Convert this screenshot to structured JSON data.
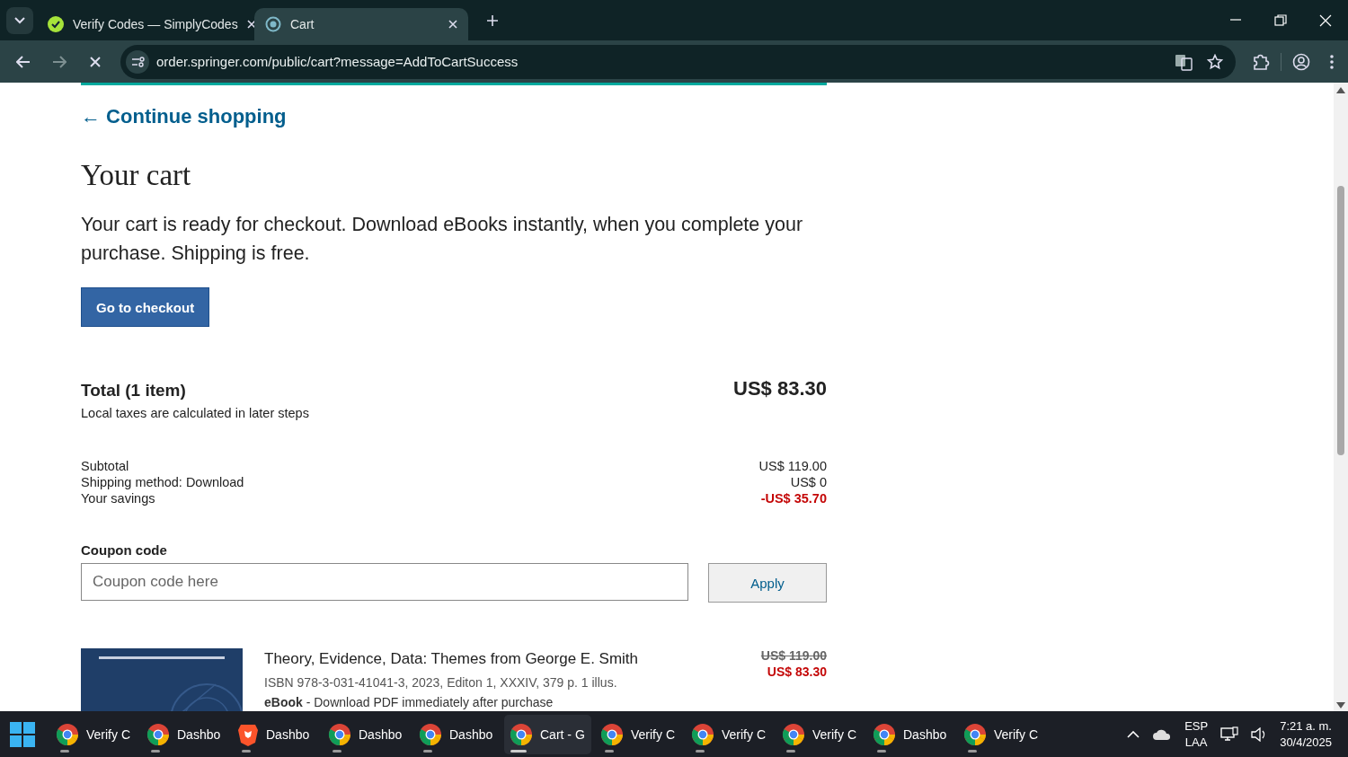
{
  "browser": {
    "tabs": [
      {
        "title": "Verify Codes — SimplyCodes",
        "kind": "simplycodes",
        "selected": false
      },
      {
        "title": "Cart",
        "kind": "springer",
        "selected": true
      }
    ],
    "url": "order.springer.com/public/cart?message=AddToCartSuccess",
    "loading": true
  },
  "page": {
    "back_link": "← Continue shopping",
    "title": "Your cart",
    "intro": "Your cart is ready for checkout. Download eBooks instantly, when you complete your purchase. Shipping is free.",
    "checkout_button": "Go to checkout",
    "total_label": "Total (1 item)",
    "total_value": "US$ 83.30",
    "tax_note": "Local taxes are calculated in later steps",
    "summary": [
      {
        "label": "Subtotal",
        "value": "US$ 119.00",
        "kind": "normal"
      },
      {
        "label": "Shipping method: Download",
        "value": "US$ 0",
        "kind": "normal"
      },
      {
        "label": "Your savings",
        "value": "-US$ 35.70",
        "kind": "discount"
      }
    ],
    "coupon": {
      "label": "Coupon code",
      "placeholder": "Coupon code here",
      "button": "Apply"
    },
    "items": [
      {
        "title": "Theory, Evidence, Data: Themes from George E. Smith",
        "details": "ISBN 978-3-031-41041-3, 2023, Editon 1, XXXIV, 379 p. 1 illus.",
        "format": "**eBook** - Download PDF immediately after purchase",
        "old_price": "US$ 119.00",
        "price": "US$ 83.30"
      }
    ]
  },
  "taskbar": {
    "apps": [
      {
        "label": "Verify C",
        "kind": "chrome",
        "selected": false
      },
      {
        "label": "Dashbo",
        "kind": "chrome",
        "selected": false
      },
      {
        "label": "Dashbo",
        "kind": "brave",
        "selected": false
      },
      {
        "label": "Dashbo",
        "kind": "chrome",
        "selected": false
      },
      {
        "label": "Dashbo",
        "kind": "chrome",
        "selected": false
      },
      {
        "label": "Cart - G",
        "kind": "chrome",
        "selected": true
      },
      {
        "label": "Verify C",
        "kind": "chrome",
        "selected": false
      },
      {
        "label": "Verify C",
        "kind": "chrome",
        "selected": false
      },
      {
        "label": "Verify C",
        "kind": "chrome",
        "selected": false
      },
      {
        "label": "Dashbo",
        "kind": "chrome",
        "selected": false
      },
      {
        "label": "Verify C",
        "kind": "chrome",
        "selected": false
      }
    ],
    "language": "ESP",
    "layout": "LAA",
    "time": "7:21 a. m.",
    "date": "30/4/2025"
  }
}
